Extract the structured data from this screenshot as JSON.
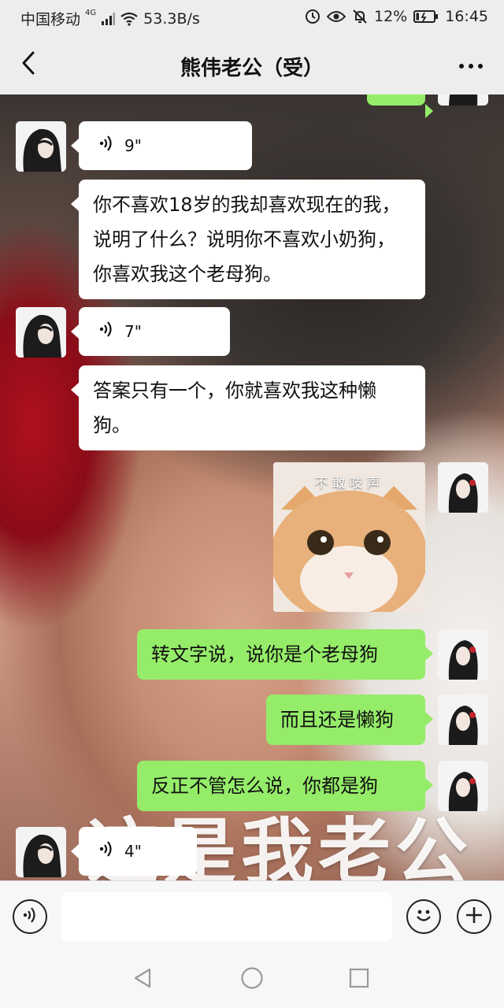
{
  "status_bar": {
    "carrier": "中国移动",
    "network_tag": "4G",
    "net_speed": "53.3B/s",
    "battery": "12%",
    "time": "16:45",
    "icons": [
      "signal-icon",
      "wifi-icon",
      "alarm-icon",
      "eye-icon",
      "mute-icon",
      "battery-icon"
    ]
  },
  "header": {
    "title": "熊伟老公（受）",
    "back_icon": "chevron-left-icon",
    "more_icon": "more-dots-icon"
  },
  "messages": [
    {
      "sender": "contact",
      "type": "voice",
      "duration": "9\""
    },
    {
      "sender": "contact",
      "type": "text",
      "text": "你不喜欢18岁的我却喜欢现在的我，说明了什么？说明你不喜欢小奶狗，你喜欢我这个老母狗。"
    },
    {
      "sender": "contact",
      "type": "voice",
      "duration": "7\""
    },
    {
      "sender": "contact",
      "type": "text",
      "text": "答案只有一个，你就喜欢我这种懒狗。"
    },
    {
      "sender": "me",
      "type": "sticker",
      "caption": "不敢吱声"
    },
    {
      "sender": "me",
      "type": "text",
      "text": "转文字说，说你是个老母狗"
    },
    {
      "sender": "me",
      "type": "text",
      "text": "而且还是懒狗"
    },
    {
      "sender": "me",
      "type": "text",
      "text": "反正不管怎么说，你都是狗"
    },
    {
      "sender": "contact",
      "type": "voice",
      "duration": "4\""
    }
  ],
  "background_watermark": "这是我老公",
  "input_bar": {
    "placeholder": "",
    "voice_icon": "voice-input-icon",
    "emoji_icon": "emoji-icon",
    "plus_icon": "plus-icon"
  },
  "system_nav": [
    "back-triangle-icon",
    "home-circle-icon",
    "recents-square-icon"
  ],
  "colors": {
    "outgoing_bubble": "#95ec69",
    "incoming_bubble": "#ffffff",
    "bar_background": "#ededed"
  }
}
